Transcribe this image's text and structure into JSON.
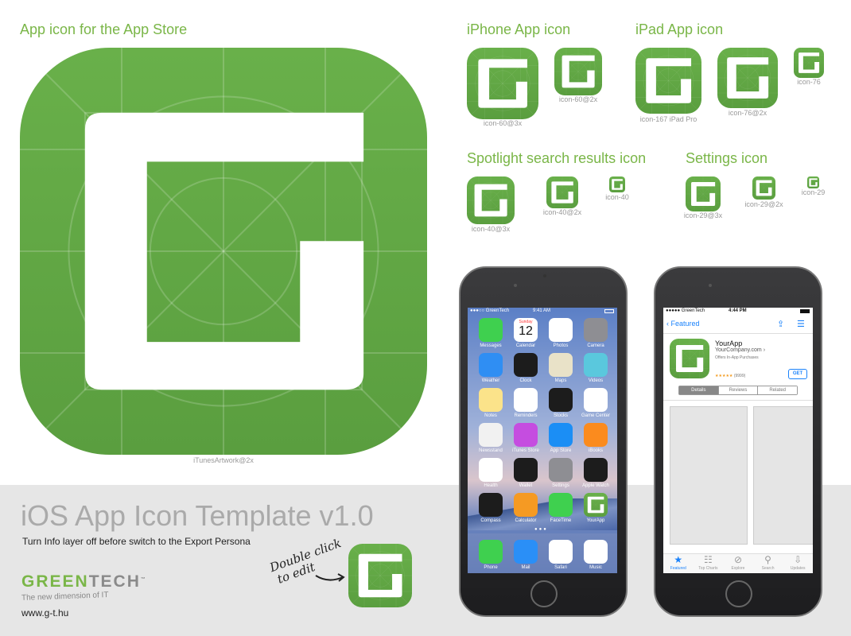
{
  "main_title": "App icon for the App Store",
  "main_label": "iTunesArtwork@2x",
  "sections": {
    "iphone": "iPhone App icon",
    "ipad": "iPad App icon",
    "spotlight": "Spotlight search results icon",
    "settings": "Settings icon"
  },
  "icons": [
    {
      "label": "icon-60@3x"
    },
    {
      "label": "icon-60@2x"
    },
    {
      "label": "icon-167 iPad Pro"
    },
    {
      "label": "icon-76@2x"
    },
    {
      "label": "icon-76"
    },
    {
      "label": "icon-40@3x"
    },
    {
      "label": "icon-40@2x"
    },
    {
      "label": "icon-40"
    },
    {
      "label": "icon-29@3x"
    },
    {
      "label": "icon-29@2x"
    },
    {
      "label": "icon-29"
    }
  ],
  "colors": {
    "icon_green": "#69b04a",
    "icon_green_dark": "#5a9e3f",
    "accent": "#7ab648",
    "ios_blue": "#1a82fb"
  },
  "footer": {
    "title": "iOS App Icon Template v1.0",
    "subtitle": "Turn Info layer off before switch to the Export Persona",
    "logo_green": "GREEN",
    "logo_gray": "TECH",
    "logo_tm": "™",
    "tagline": "The new dimension of IT",
    "url": "www.g-t.hu",
    "hint_line1": "Double click",
    "hint_line2": "to edit"
  },
  "home_screen": {
    "carrier": "●●●○○ GreenTech",
    "time": "9:41 AM",
    "calendar_day": "Sunday",
    "calendar_date": "12",
    "apps": [
      {
        "name": "Messages",
        "color": "#3fd04f"
      },
      {
        "name": "Calendar",
        "color": "#ffffff"
      },
      {
        "name": "Photos",
        "color": "#ffffff"
      },
      {
        "name": "Camera",
        "color": "#8e8e93"
      },
      {
        "name": "Weather",
        "color": "#2f8ef3"
      },
      {
        "name": "Clock",
        "color": "#1c1c1c"
      },
      {
        "name": "Maps",
        "color": "#e9e2c8"
      },
      {
        "name": "Videos",
        "color": "#5ac8dd"
      },
      {
        "name": "Notes",
        "color": "#fbe38a"
      },
      {
        "name": "Reminders",
        "color": "#ffffff"
      },
      {
        "name": "Stocks",
        "color": "#1c1c1c"
      },
      {
        "name": "Game Center",
        "color": "#ffffff"
      },
      {
        "name": "Newsstand",
        "color": "#f1f1f1"
      },
      {
        "name": "iTunes Store",
        "color": "#c54de0"
      },
      {
        "name": "App Store",
        "color": "#1b8ef5"
      },
      {
        "name": "iBooks",
        "color": "#fb8b1e"
      },
      {
        "name": "Health",
        "color": "#ffffff"
      },
      {
        "name": "Wallet",
        "color": "#1c1c1c"
      },
      {
        "name": "Settings",
        "color": "#8e8e93"
      },
      {
        "name": "Apple Watch",
        "color": "#1c1c1c"
      },
      {
        "name": "Compass",
        "color": "#1c1c1c"
      },
      {
        "name": "Calculator",
        "color": "#f59a23"
      },
      {
        "name": "FaceTime",
        "color": "#3fd04f"
      },
      {
        "name": "YourApp",
        "color": "#69b04a"
      }
    ],
    "dock": [
      {
        "name": "Phone",
        "color": "#3fd04f"
      },
      {
        "name": "Mail",
        "color": "#2a8ff7"
      },
      {
        "name": "Safari",
        "color": "#ffffff"
      },
      {
        "name": "Music",
        "color": "#ffffff"
      }
    ]
  },
  "app_store": {
    "carrier": "●●●●● GreenTech",
    "time": "4:44 PM",
    "back": "Featured",
    "app_name": "YourApp",
    "company": "YourCompany.com ›",
    "iap": "Offers In-App Purchases",
    "stars": "★★★★★",
    "rating_count": "(9999)",
    "get": "GET",
    "segments": [
      "Details",
      "Reviews",
      "Related"
    ],
    "tabs": [
      "Featured",
      "Top Charts",
      "Explore",
      "Search",
      "Updates"
    ],
    "tab_icons": [
      "star-icon",
      "list-icon",
      "compass-icon",
      "search-icon",
      "download-icon"
    ]
  }
}
